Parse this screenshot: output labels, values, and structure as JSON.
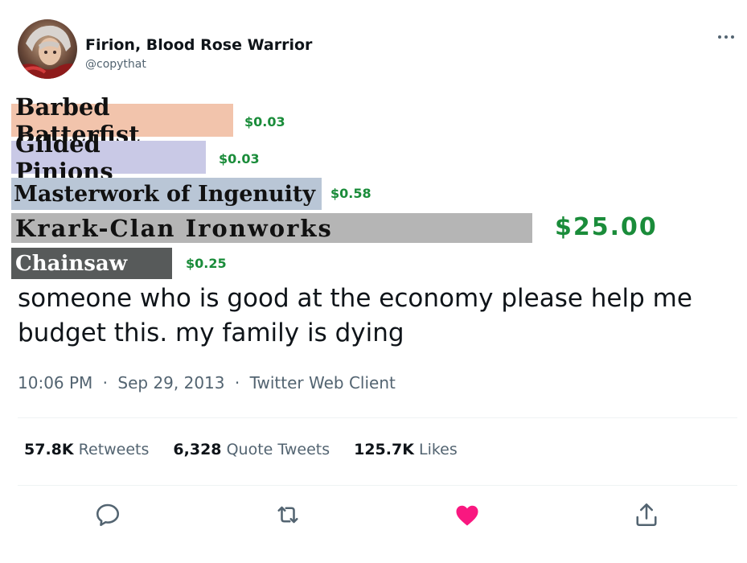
{
  "author": {
    "display_name": "Firion, Blood Rose Warrior",
    "handle": "@copythat",
    "avatar_icon": "character-portrait-avatar"
  },
  "header": {
    "more_icon": "ellipsis-icon"
  },
  "media": {
    "cards": [
      {
        "name": "Barbed Batterfist",
        "price": "$0.03",
        "background": "#f2c4ac"
      },
      {
        "name": "Gilded Pinions",
        "price": "$0.03",
        "background": "#c9c9e6"
      },
      {
        "name": "Masterwork of Ingenuity",
        "price": "$0.58",
        "background": "#b9c6d6"
      },
      {
        "name": "Krark-Clan Ironworks",
        "price": "$25.00",
        "background": "#b5b5b5"
      },
      {
        "name": "Chainsaw",
        "price": "$0.25",
        "background": "#575a5a"
      }
    ]
  },
  "tweet": {
    "text_line_1": "someone who is good at the economy please help me",
    "text_line_2": "budget this. my family is dying",
    "time": "10:06 PM",
    "date": "Sep 29, 2013",
    "client": "Twitter Web Client"
  },
  "stats": {
    "retweets_count": "57.8K",
    "retweets_label": "Retweets",
    "quotes_count": "6,328",
    "quotes_label": "Quote Tweets",
    "likes_count": "125.7K",
    "likes_label": "Likes"
  },
  "actions": {
    "reply_icon": "reply-icon",
    "retweet_icon": "retweet-icon",
    "like_icon": "heart-icon",
    "share_icon": "share-icon",
    "like_color": "#f91880",
    "icon_color": "#536471"
  },
  "colors": {
    "price_green": "#1a8c3a",
    "text_primary": "#0f1419",
    "text_secondary": "#536471"
  }
}
